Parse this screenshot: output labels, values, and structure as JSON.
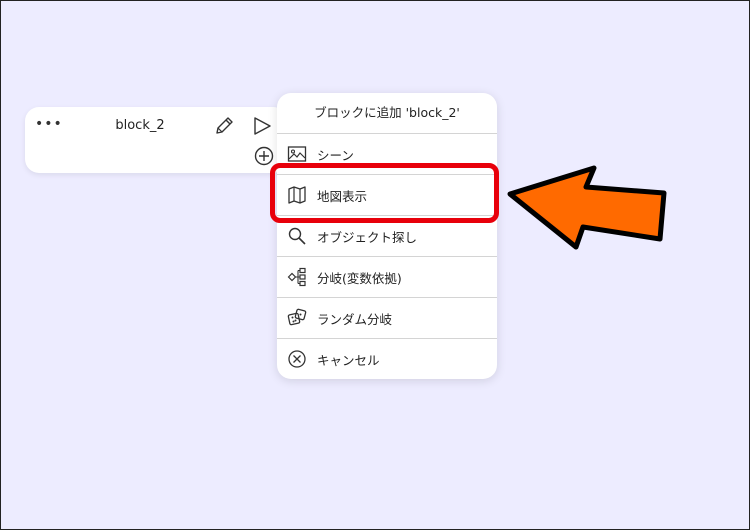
{
  "block": {
    "dots": "•••",
    "title": "block_2",
    "icons": [
      "pencil-icon",
      "play-icon",
      "plus-circle-icon"
    ]
  },
  "menu": {
    "header": "ブロックに追加 'block_2'",
    "items": [
      {
        "label": "シーン",
        "icon": "image-icon"
      },
      {
        "label": "地図表示",
        "icon": "map-icon"
      },
      {
        "label": "オブジェクト探し",
        "icon": "search-icon"
      },
      {
        "label": "分岐(変数依拠)",
        "icon": "branch-icon"
      },
      {
        "label": "ランダム分岐",
        "icon": "dice-icon"
      },
      {
        "label": "キャンセル",
        "icon": "cancel-circle-icon"
      }
    ]
  },
  "colors": {
    "background": "#edecff",
    "highlight": "#e8000b",
    "arrow_fill": "#ff6a00",
    "arrow_stroke": "#000000"
  }
}
